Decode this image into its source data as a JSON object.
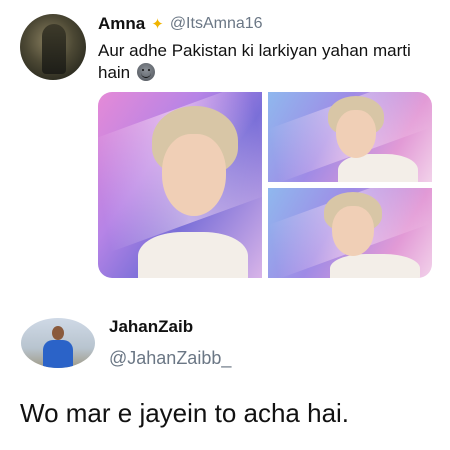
{
  "tweet": {
    "name": "Amna",
    "badge_icon": "sparkle-icon",
    "handle": "@ItsAmna16",
    "text": "Aur adhe Pakistan ki larkiyan yahan marti hain",
    "emoji_icon": "smiling-face-emoji",
    "photos": [
      "photo-1",
      "photo-2",
      "photo-3"
    ]
  },
  "reply": {
    "name": "JahanZaib",
    "handle": "@JahanZaibb_",
    "text": "Wo mar e jayein to acha hai."
  }
}
